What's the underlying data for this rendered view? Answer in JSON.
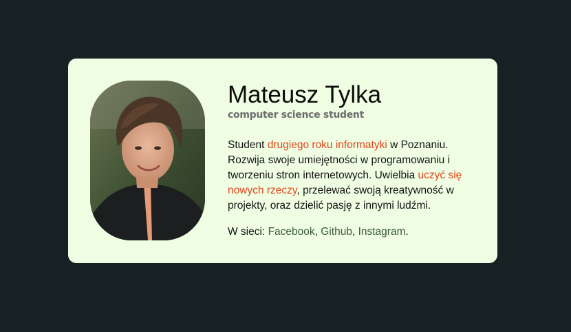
{
  "profile": {
    "name": "Mateusz Tylka",
    "subtitle": "computer science student",
    "photo_alt": "portrait photo"
  },
  "bio": {
    "p1": "Student ",
    "h1": "drugiego roku informatyki",
    "p2": " w Poznaniu. Rozwija swoje umiejętności w programowaniu i tworzeniu stron internetowych. Uwielbia ",
    "h2": "uczyć się nowych rzeczy",
    "p3": ", przelewać swoją kreatywność w projekty, oraz dzielić pasję z innymi ludźmi."
  },
  "links": {
    "prefix": "W sieci: ",
    "facebook": "Facebook",
    "sep1": ", ",
    "github": "Github",
    "sep2": ", ",
    "instagram": "Instagram",
    "suffix": "."
  },
  "colors": {
    "background": "#172022",
    "card": "#effde3",
    "highlight": "#e2461b",
    "link": "#3c5a3a"
  }
}
